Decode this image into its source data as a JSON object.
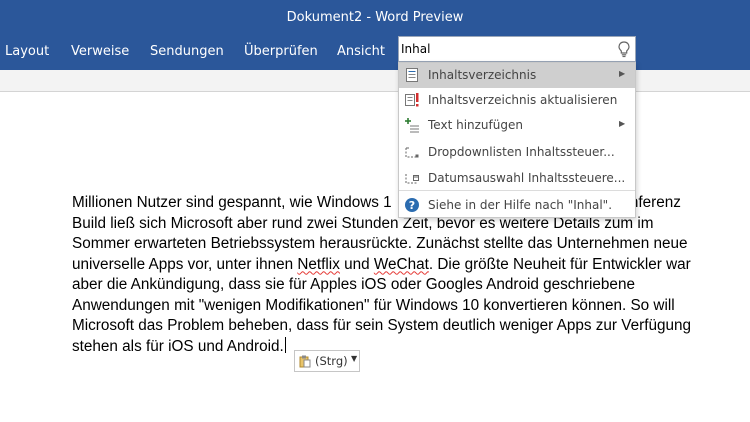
{
  "window": {
    "title": "Dokument2 - Word Preview"
  },
  "ribbon": {
    "tabs": [
      "Layout",
      "Verweise",
      "Sendungen",
      "Überprüfen",
      "Ansicht"
    ]
  },
  "tell_me": {
    "value": "Inhal"
  },
  "suggestions": [
    {
      "label": "Inhaltsverzeichnis",
      "icon": "table-of-contents-icon",
      "submenu": true,
      "selected": true
    },
    {
      "label": "Inhaltsverzeichnis aktualisieren",
      "icon": "update-table-icon",
      "submenu": false
    },
    {
      "label": "Text hinzufügen",
      "icon": "add-text-icon",
      "submenu": true
    },
    {
      "label": "Dropdownlisten Inhaltssteuer...",
      "icon": "dropdown-control-icon",
      "submenu": false
    },
    {
      "label": "Datumsauswahl Inhaltssteuere...",
      "icon": "date-picker-control-icon",
      "submenu": false
    },
    {
      "label": "Siehe in der Hilfe nach \"Inhal\".",
      "icon": "help-icon",
      "submenu": false
    }
  ],
  "document": {
    "p1": "Millionen Nutzer sind gespannt, wie Windows 1",
    "p2": "konferenz",
    "p3": "Build ließ sich Microsoft aber rund zwei Stunden Zeit, bevor es weitere Details zum im",
    "p4": "Sommer erwarteten Betriebssystem herausrückte. Zunächst stellte das Unternehmen neue",
    "p5": "universelle Apps vor, unter ihnen ",
    "p5_netflix": "Netflix",
    "p5_mid": " und ",
    "p5_wechat": "WeChat",
    "p5_end": ". Die größte Neuheit für Entwickler war",
    "p6": "aber die Ankündigung, dass sie für Apples iOS oder Googles Android geschriebene",
    "p7": "Anwendungen mit \"wenigen Modifikationen\" für Windows 10 konvertieren können. So will",
    "p8": "Microsoft das Problem beheben, dass für sein System deutlich weniger Apps zur Verfügung",
    "p9": "stehen als für iOS und Android."
  },
  "paste_options": {
    "label": "(Strg)"
  },
  "colors": {
    "ribbon": "#2b579a",
    "selected_item": "#cfcfcf",
    "help_icon": "#2b6cb0"
  }
}
